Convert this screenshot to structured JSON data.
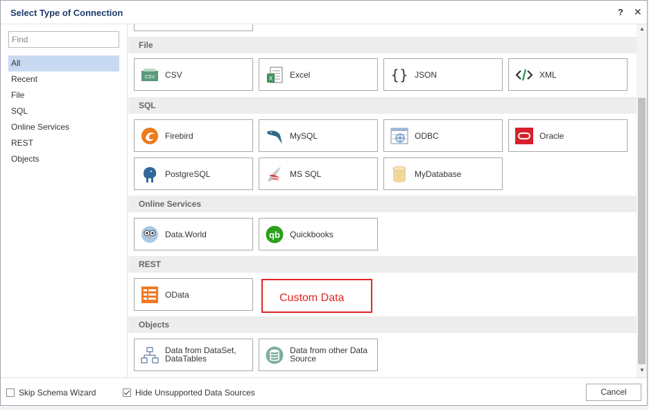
{
  "dialog": {
    "title": "Select Type of Connection",
    "help_label": "?",
    "close_label": "✕"
  },
  "left": {
    "search_placeholder": "Find",
    "categories": [
      "All",
      "Recent",
      "File",
      "SQL",
      "Online Services",
      "REST",
      "Objects"
    ],
    "active_category": "All"
  },
  "sections": {
    "file": {
      "title": "File",
      "items": [
        {
          "label": "CSV",
          "icon": "csv-icon"
        },
        {
          "label": "Excel",
          "icon": "excel-icon"
        },
        {
          "label": "JSON",
          "icon": "json-icon"
        },
        {
          "label": "XML",
          "icon": "xml-icon"
        }
      ]
    },
    "sql": {
      "title": "SQL",
      "items": [
        {
          "label": "Firebird",
          "icon": "firebird-icon"
        },
        {
          "label": "MySQL",
          "icon": "mysql-dolphin-icon"
        },
        {
          "label": "ODBC",
          "icon": "odbc-icon"
        },
        {
          "label": "Oracle",
          "icon": "oracle-icon"
        },
        {
          "label": "PostgreSQL",
          "icon": "postgresql-elephant-icon"
        },
        {
          "label": "MS SQL",
          "icon": "mssql-icon"
        },
        {
          "label": "MyDatabase",
          "icon": "database-cylinder-icon"
        }
      ]
    },
    "online": {
      "title": "Online Services",
      "items": [
        {
          "label": "Data.World",
          "icon": "data-world-owl-icon"
        },
        {
          "label": "Quickbooks",
          "icon": "quickbooks-icon"
        }
      ]
    },
    "rest": {
      "title": "REST",
      "items": [
        {
          "label": "OData",
          "icon": "odata-icon"
        }
      ],
      "annotation": "Custom Data"
    },
    "objects": {
      "title": "Objects",
      "items": [
        {
          "label": "Data from DataSet, DataTables",
          "icon": "dataset-hierarchy-icon"
        },
        {
          "label": "Data from other Data Source",
          "icon": "data-source-icon"
        }
      ]
    }
  },
  "footer": {
    "skip_schema_label": "Skip Schema Wizard",
    "skip_schema_checked": false,
    "hide_unsupported_label": "Hide Unsupported Data Sources",
    "hide_unsupported_checked": true,
    "cancel_label": "Cancel"
  },
  "colors": {
    "title": "#1e3a6a",
    "active_category_bg": "#c8d9f2",
    "section_bg": "#ededed",
    "annotation_red": "#e02424"
  }
}
